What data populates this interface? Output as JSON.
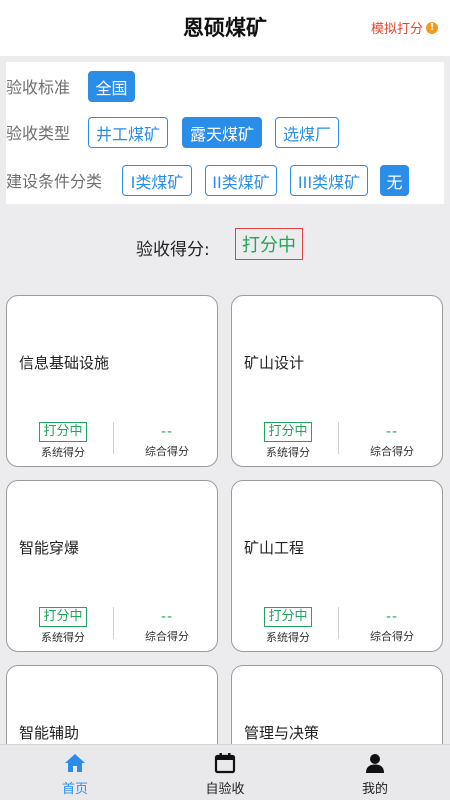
{
  "header": {
    "title": "恩硕煤矿",
    "sim_label": "模拟打分",
    "sim_icon": "warning-icon"
  },
  "filters": {
    "standard": {
      "label": "验收标准",
      "options": [
        "全国"
      ],
      "selected": "全国"
    },
    "type": {
      "label": "验收类型",
      "options": [
        "井工煤矿",
        "露天煤矿",
        "选煤厂"
      ],
      "selected": "露天煤矿"
    },
    "condition": {
      "label": "建设条件分类",
      "options": [
        "I类煤矿",
        "II类煤矿",
        "III类煤矿",
        "无"
      ],
      "selected": "无"
    }
  },
  "score": {
    "label": "验收得分:",
    "status": "打分中"
  },
  "cards": [
    {
      "title": "信息基础设施",
      "status": "打分中",
      "status_caption": "系统得分",
      "value": "--",
      "value_caption": "综合得分"
    },
    {
      "title": "矿山设计",
      "status": "打分中",
      "status_caption": "系统得分",
      "value": "--",
      "value_caption": "综合得分"
    },
    {
      "title": "智能穿爆",
      "status": "打分中",
      "status_caption": "系统得分",
      "value": "--",
      "value_caption": "综合得分"
    },
    {
      "title": "矿山工程",
      "status": "打分中",
      "status_caption": "系统得分",
      "value": "--",
      "value_caption": "综合得分"
    },
    {
      "title": "智能辅助"
    },
    {
      "title": "管理与决策"
    }
  ],
  "tabs": [
    {
      "label": "首页",
      "icon": "home-icon",
      "active": true
    },
    {
      "label": "自验收",
      "icon": "calendar-icon",
      "active": false
    },
    {
      "label": "我的",
      "icon": "user-icon",
      "active": false
    }
  ],
  "colors": {
    "accent": "#2a8ee8",
    "green": "#20a55a",
    "red": "#e04545",
    "orange": "#f39a1e"
  }
}
